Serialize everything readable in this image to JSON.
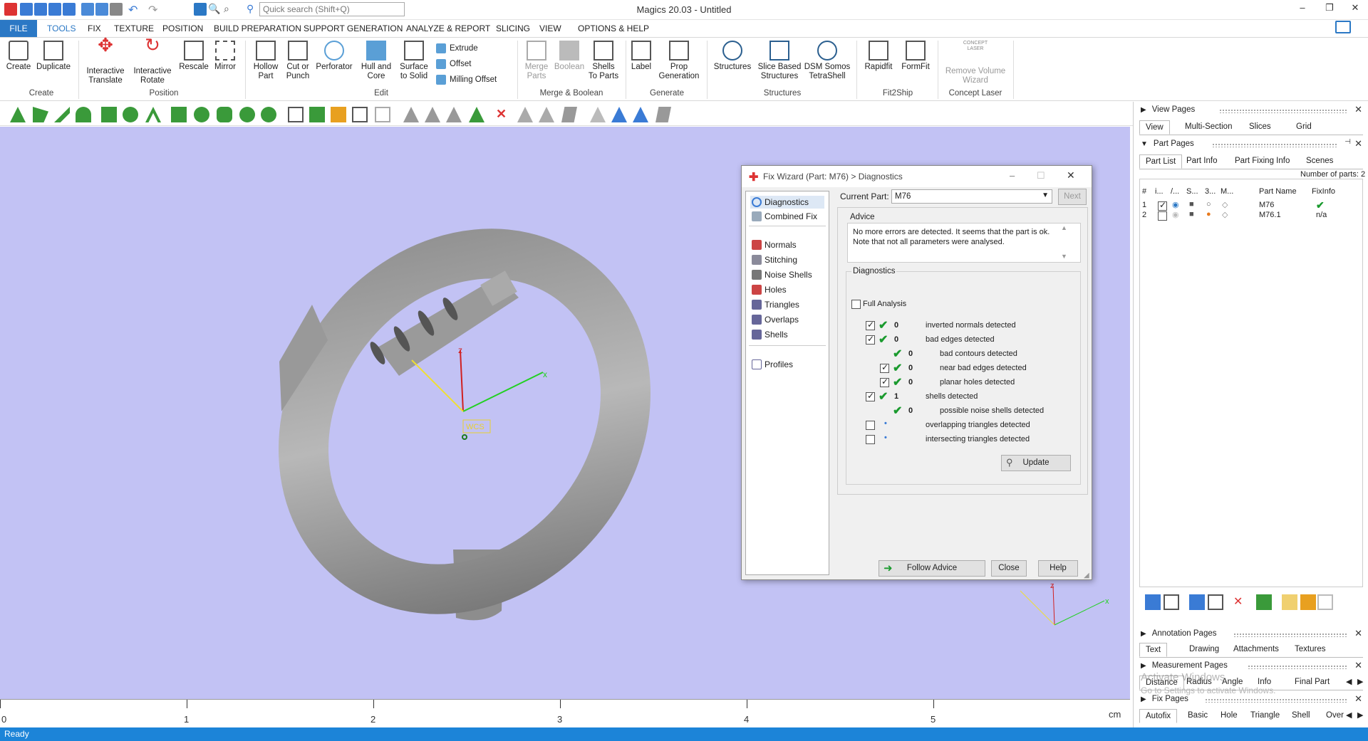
{
  "titlebar": {
    "title": "Magics 20.03 - Untitled",
    "search_placeholder": "Quick search (Shift+Q)",
    "min": "–",
    "restore": "❐",
    "close": "✕"
  },
  "menu": [
    "FILE",
    "TOOLS",
    "FIX",
    "TEXTURE",
    "POSITION",
    "BUILD PREPARATION",
    "SUPPORT GENERATION",
    "ANALYZE & REPORT",
    "SLICING",
    "VIEW",
    "OPTIONS & HELP"
  ],
  "ribbon": {
    "create": "Create",
    "duplicate": "Duplicate",
    "group_create": "Create",
    "interactive_translate": "Interactive\nTranslate",
    "interactive_rotate": "Interactive\nRotate",
    "rescale": "Rescale",
    "mirror": "Mirror",
    "group_position": "Position",
    "hollow_part": "Hollow\nPart",
    "cut_or_punch": "Cut or\nPunch",
    "perforator": "Perforator",
    "hull_and_core": "Hull and\nCore",
    "surface_to_solid": "Surface\nto Solid",
    "extrude": "Extrude",
    "offset": "Offset",
    "milling_offset": "Milling Offset",
    "group_edit": "Edit",
    "merge_parts": "Merge\nParts",
    "boolean": "Boolean",
    "shells_to_parts": "Shells\nTo Parts",
    "group_merge": "Merge & Boolean",
    "label": "Label",
    "prop_generation": "Prop\nGeneration",
    "group_generate": "Generate",
    "structures": "Structures",
    "slice_based": "Slice Based\nStructures",
    "dsm_somos": "DSM Somos\nTetraShell",
    "group_structures": "Structures",
    "rapidfit": "Rapidfit",
    "formfit": "FormFit",
    "group_fit2ship": "Fit2Ship",
    "concept_laser_logo": "CONCEPT\nLASER",
    "remove_volume": "Remove Volume\nWizard",
    "group_concept": "Concept Laser"
  },
  "viewport": {
    "wcs_label": "WCS",
    "axis_x": "x",
    "axis_z": "z"
  },
  "ruler": {
    "labels": [
      "0",
      "1",
      "2",
      "3",
      "4",
      "5"
    ],
    "unit": "cm"
  },
  "status": "Ready",
  "dialog": {
    "title": "Fix Wizard (Part: M76) > Diagnostics",
    "nav": [
      "Diagnostics",
      "Combined Fix",
      "Normals",
      "Stitching",
      "Noise Shells",
      "Holes",
      "Triangles",
      "Overlaps",
      "Shells",
      "Profiles"
    ],
    "current_part_label": "Current Part:",
    "current_part_value": "M76",
    "next": "Next",
    "advice_title": "Advice",
    "advice_text": "No more errors are detected. It seems that the part is ok.\nNote that not all parameters were analysed.",
    "diag_title": "Diagnostics",
    "full_analysis": "Full Analysis",
    "rows": [
      {
        "count": "0",
        "text": "inverted normals detected"
      },
      {
        "count": "0",
        "text": "bad edges detected"
      },
      {
        "count": "0",
        "text": "bad contours detected"
      },
      {
        "count": "0",
        "text": "near bad edges detected"
      },
      {
        "count": "0",
        "text": "planar holes detected"
      },
      {
        "count": "1",
        "text": "shells detected"
      },
      {
        "count": "0",
        "text": "possible noise shells detected"
      },
      {
        "count": "•",
        "text": "overlapping triangles detected"
      },
      {
        "count": "•",
        "text": "intersecting triangles detected"
      }
    ],
    "update": "Update",
    "follow_advice": "Follow Advice",
    "close": "Close",
    "help": "Help"
  },
  "rpanel": {
    "view_pages": "View Pages",
    "view_tabs": [
      "View",
      "Multi-Section",
      "Slices",
      "Grid"
    ],
    "part_pages": "Part Pages",
    "part_tabs": [
      "Part List",
      "Part Info",
      "Part Fixing Info",
      "Scenes"
    ],
    "num_parts": "Number of parts: 2",
    "cols": [
      "#",
      "i...",
      "/...",
      "S...",
      "3...",
      "M...",
      "Part Name",
      "FixInfo"
    ],
    "rows": [
      {
        "num": "1",
        "name": "M76",
        "fix": "✔"
      },
      {
        "num": "2",
        "name": "M76.1",
        "fix": "n/a"
      }
    ],
    "annotation_pages": "Annotation Pages",
    "annotation_tabs": [
      "Text",
      "Drawing",
      "Attachments",
      "Textures"
    ],
    "measurement_pages": "Measurement Pages",
    "measurement_tabs": [
      "Distance",
      "Radius",
      "Angle",
      "Info",
      "Final Part"
    ],
    "fix_pages": "Fix Pages",
    "fix_tabs": [
      "Autofix",
      "Basic",
      "Hole",
      "Triangle",
      "Shell",
      "Over"
    ],
    "watermark1": "Activate Windows",
    "watermark2": "Go to Settings to activate Windows."
  },
  "colors": {
    "accent": "#2b78c5",
    "viewport": "#c2c2f4",
    "status": "#1c84d8",
    "check": "#1a9a2e"
  }
}
